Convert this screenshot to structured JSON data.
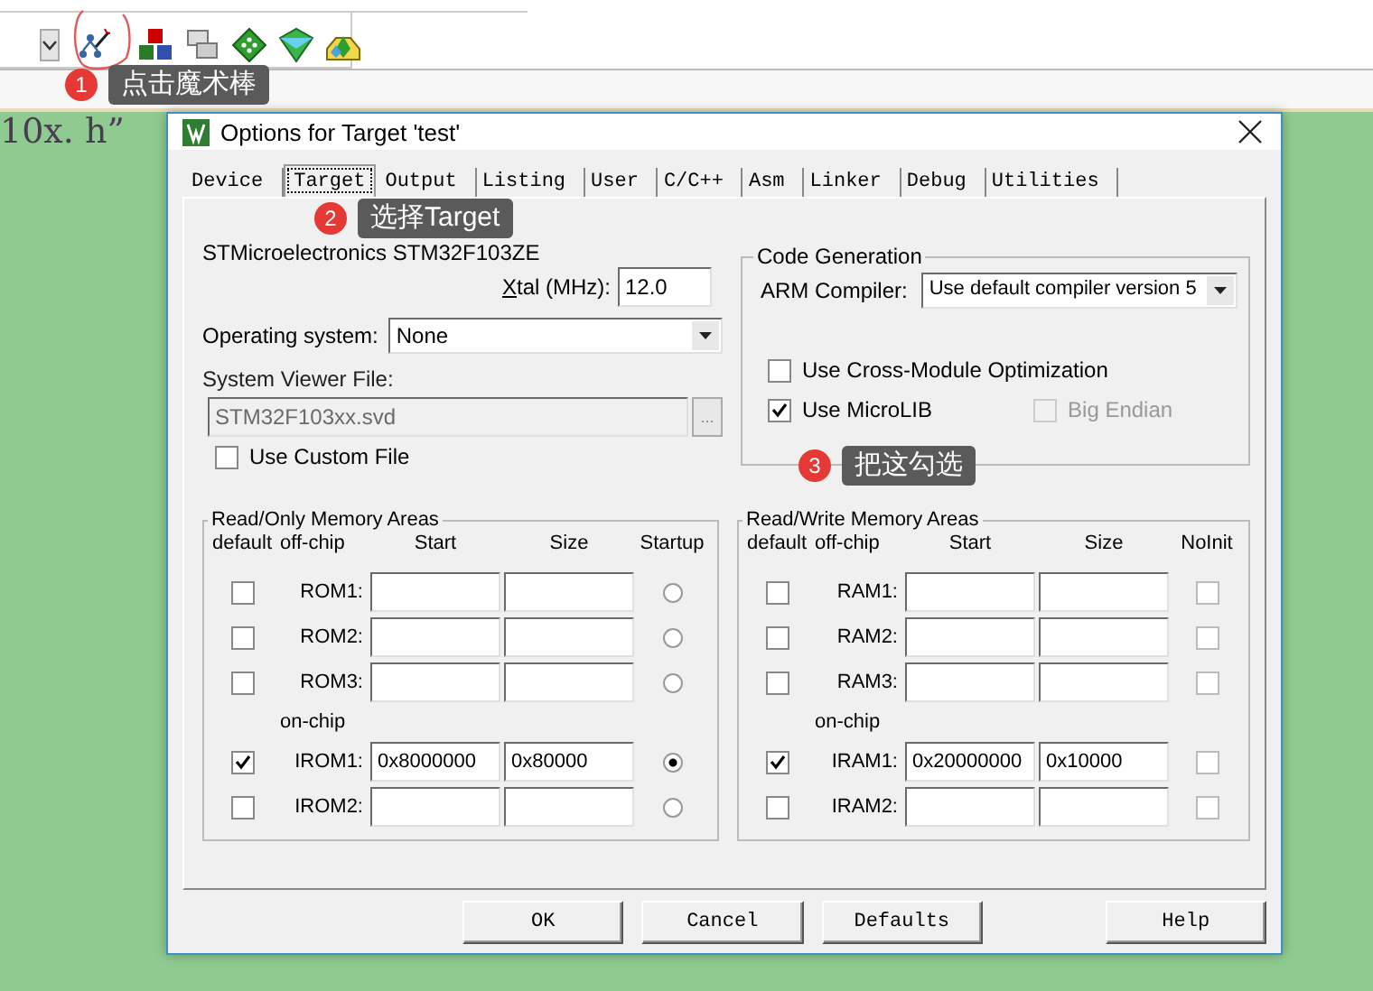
{
  "editor": {
    "text": "10x. h”"
  },
  "callouts": [
    {
      "number": "1",
      "text": "点击魔术棒",
      "kind": "toolbar"
    },
    {
      "number": "2",
      "text": "选择Target",
      "kind": "tab"
    },
    {
      "number": "3",
      "text": "把这勾选",
      "kind": "option"
    }
  ],
  "dialog": {
    "title": "Options for Target 'test'",
    "tabs": [
      {
        "label": "Device",
        "selected": false
      },
      {
        "label": "Target",
        "selected": true
      },
      {
        "label": "Output",
        "selected": false
      },
      {
        "label": "Listing",
        "selected": false
      },
      {
        "label": "User",
        "selected": false
      },
      {
        "label": "C/C++",
        "selected": false
      },
      {
        "label": "Asm",
        "selected": false
      },
      {
        "label": "Linker",
        "selected": false
      },
      {
        "label": "Debug",
        "selected": false
      },
      {
        "label": "Utilities",
        "selected": false
      }
    ],
    "device": "STMicroelectronics STM32F103ZE",
    "xtal": {
      "label": "Xtal (MHz):",
      "value": "12.0"
    },
    "os": {
      "label": "Operating system:",
      "value": "None"
    },
    "svd": {
      "label": "System Viewer File:",
      "value": "STM32F103xx.svd",
      "browse": "...",
      "disabled": true
    },
    "custom_file": {
      "label": "Use Custom File",
      "checked": false
    },
    "code_generation": {
      "title": "Code Generation",
      "compiler_label": "ARM Compiler:",
      "compiler": "Use default compiler version 5",
      "options": [
        {
          "label": "Use Cross-Module Optimization",
          "checked": false,
          "disabled": false
        },
        {
          "label": "Use MicroLIB",
          "checked": true,
          "disabled": false
        },
        {
          "label": "Big Endian",
          "checked": false,
          "disabled": true
        }
      ]
    },
    "rom": {
      "title": "Read/Only Memory Areas",
      "columns": [
        "default",
        "off-chip",
        "Start",
        "Size",
        "Startup"
      ],
      "off_chip": [
        {
          "name": "ROM1:",
          "default": false,
          "selected": false
        },
        {
          "name": "ROM2:",
          "default": false,
          "selected": false
        },
        {
          "name": "ROM3:",
          "default": false,
          "selected": false
        }
      ],
      "on_chip_label": "on-chip",
      "on_chip": [
        {
          "name": "IROM1:",
          "default": true,
          "start": "0x8000000",
          "size": "0x80000",
          "selected": true
        },
        {
          "name": "IROM2:",
          "default": false,
          "selected": false
        }
      ]
    },
    "ram": {
      "title": "Read/Write Memory Areas",
      "columns": [
        "default",
        "off-chip",
        "Start",
        "Size",
        "NoInit"
      ],
      "off_chip": [
        {
          "name": "RAM1:",
          "default": false,
          "noinit": false
        },
        {
          "name": "RAM2:",
          "default": false,
          "noinit": false
        },
        {
          "name": "RAM3:",
          "default": false,
          "noinit": false
        }
      ],
      "on_chip_label": "on-chip",
      "on_chip": [
        {
          "name": "IRAM1:",
          "default": true,
          "start": "0x20000000",
          "size": "0x10000",
          "noinit": false
        },
        {
          "name": "IRAM2:",
          "default": false,
          "noinit": false
        }
      ]
    },
    "buttons": [
      "OK",
      "Cancel",
      "Defaults",
      "Help"
    ]
  }
}
